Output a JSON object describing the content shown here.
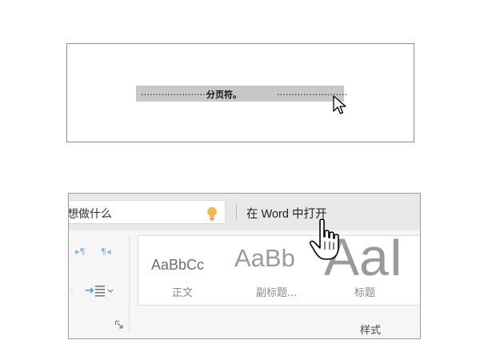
{
  "top_panel": {
    "pagebreak_dots_left": "……………………",
    "pagebreak_label": "分页符。",
    "pagebreak_dots_right": "……………………"
  },
  "bottom_panel": {
    "search_text": "想做什么",
    "open_in_word_label": "在 Word 中打开",
    "paragraph_icons": [
      "▸¶",
      "¶◂"
    ],
    "styles": [
      {
        "sample": "AaBbCc",
        "name": "正文"
      },
      {
        "sample": "AaBb",
        "name": "副标题..."
      },
      {
        "sample": "AaI",
        "name": "标题"
      }
    ],
    "styles_group_label": "样式"
  },
  "icons": {
    "bulb": "lightbulb-icon",
    "arrow_cursor": "arrow-cursor-icon",
    "hand_cursor": "hand-pointer-icon",
    "launcher": "dialog-launcher-icon"
  },
  "colors": {
    "bulb": "#f2b94a",
    "pagebreak_bar": "#c8c8c8",
    "ribbon_bg": "#f6f6f6",
    "topbar_bg": "#e8e8e8"
  }
}
